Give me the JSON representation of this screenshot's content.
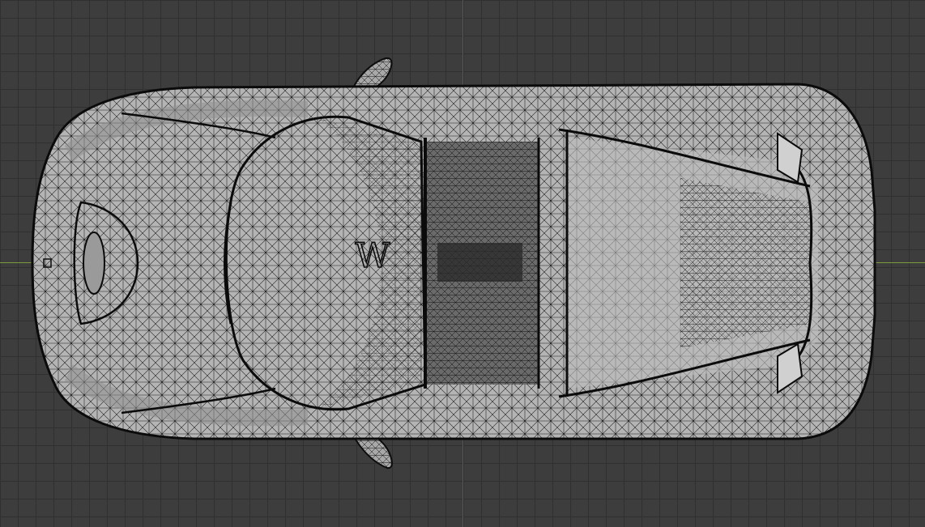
{
  "viewport": {
    "view": "top",
    "shading": "wireframe",
    "background_color": "#3d3d3d",
    "grid_color": "#303030",
    "x_axis_color": "#7a9a3c",
    "y_axis_color": "#b0303a"
  },
  "model": {
    "name": "car-body-mesh",
    "surface_color": "#b4b4b4",
    "wire_color": "#111111",
    "badge_text": "W"
  }
}
